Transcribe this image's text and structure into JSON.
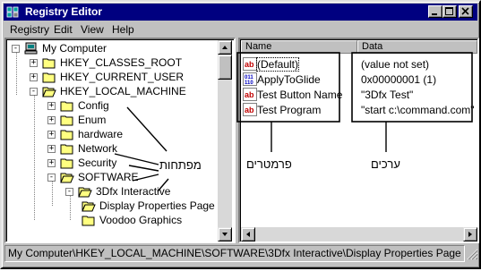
{
  "window": {
    "title": "Registry Editor"
  },
  "caption_buttons": [
    "minimize",
    "maximize",
    "close"
  ],
  "menu": [
    "Registry",
    "Edit",
    "View",
    "Help"
  ],
  "tree": {
    "items": [
      {
        "label": "My Computer",
        "icon": "computer-icon",
        "expander": "-"
      },
      {
        "label": "HKEY_CLASSES_ROOT",
        "icon": "folder-icon",
        "expander": "+"
      },
      {
        "label": "HKEY_CURRENT_USER",
        "icon": "folder-icon",
        "expander": "+"
      },
      {
        "label": "HKEY_LOCAL_MACHINE",
        "icon": "folder-open-icon",
        "expander": "-"
      },
      {
        "label": "Config",
        "icon": "folder-icon",
        "expander": "+"
      },
      {
        "label": "Enum",
        "icon": "folder-icon",
        "expander": "+"
      },
      {
        "label": "hardware",
        "icon": "folder-icon",
        "expander": "+"
      },
      {
        "label": "Network",
        "icon": "folder-icon",
        "expander": "+"
      },
      {
        "label": "Security",
        "icon": "folder-icon",
        "expander": "+"
      },
      {
        "label": "SOFTWARE",
        "icon": "folder-open-icon",
        "expander": "-"
      },
      {
        "label": "3Dfx Interactive",
        "icon": "folder-open-icon",
        "expander": "-"
      },
      {
        "label": "Display Properties Page",
        "icon": "folder-open-icon",
        "expander": ""
      },
      {
        "label": "Voodoo Graphics",
        "icon": "folder-icon",
        "expander": ""
      }
    ]
  },
  "list": {
    "headers": {
      "name": "Name",
      "data": "Data"
    },
    "rows": [
      {
        "name": "(Default)",
        "data": "(value not set)",
        "icon": "string-value-icon"
      },
      {
        "name": "ApplyToGlide",
        "data": "0x00000001 (1)",
        "icon": "binary-value-icon"
      },
      {
        "name": "Test Button Name",
        "data": "\"3Dfx Test\"",
        "icon": "string-value-icon"
      },
      {
        "name": "Test Program",
        "data": "\"start c:\\command.com\"",
        "icon": "string-value-icon"
      }
    ]
  },
  "annotations": {
    "keys": "מפתחות",
    "parameters": "פרמטרים",
    "values": "ערכים"
  },
  "status": {
    "path": "My Computer\\HKEY_LOCAL_MACHINE\\SOFTWARE\\3Dfx Interactive\\Display Properties Page"
  },
  "colors": {
    "titlebar": "#000080",
    "face": "#c0c0c0",
    "string_icon_red": "#c00000",
    "binary_icon_blue": "#0000c0"
  }
}
